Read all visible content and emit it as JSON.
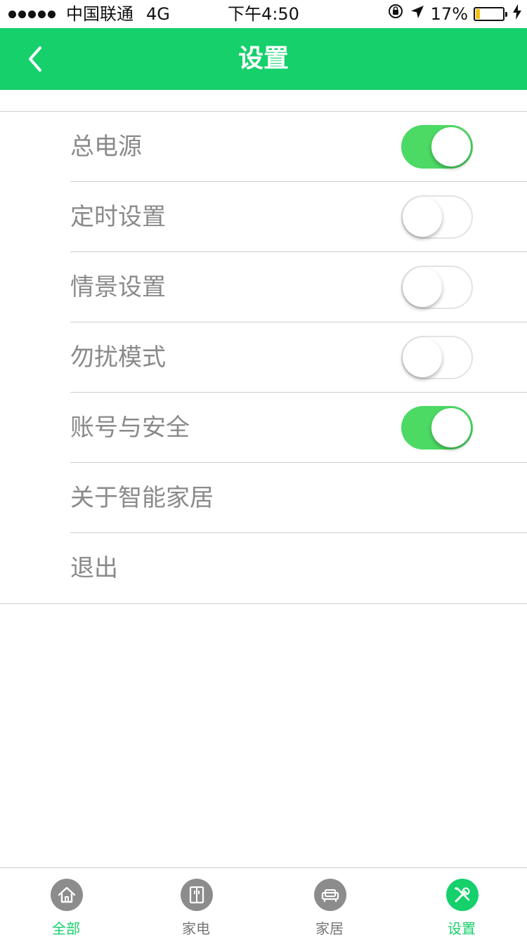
{
  "colors": {
    "brand": "#15d06b",
    "toggle_on": "#4cd964",
    "battery_level": "#f4c417",
    "text_muted": "#8a8a8a"
  },
  "status_bar": {
    "carrier": "中国联通",
    "network": "4G",
    "time": "下午4:50",
    "battery_text": "17%",
    "battery_level": 0.17
  },
  "nav": {
    "title": "设置",
    "back_icon": "chevron-left-icon"
  },
  "settings": [
    {
      "label": "总电源",
      "toggle": true,
      "on": true
    },
    {
      "label": "定时设置",
      "toggle": true,
      "on": false
    },
    {
      "label": "情景设置",
      "toggle": true,
      "on": false
    },
    {
      "label": "勿扰模式",
      "toggle": true,
      "on": false
    },
    {
      "label": "账号与安全",
      "toggle": true,
      "on": true
    },
    {
      "label": "关于智能家居",
      "toggle": false
    },
    {
      "label": "退出",
      "toggle": false
    }
  ],
  "tabs": [
    {
      "label": "全部",
      "icon": "home-icon",
      "active": false,
      "label_highlight": true
    },
    {
      "label": "家电",
      "icon": "appliance-icon",
      "active": false
    },
    {
      "label": "家居",
      "icon": "sofa-icon",
      "active": false
    },
    {
      "label": "设置",
      "icon": "tools-icon",
      "active": true
    }
  ]
}
